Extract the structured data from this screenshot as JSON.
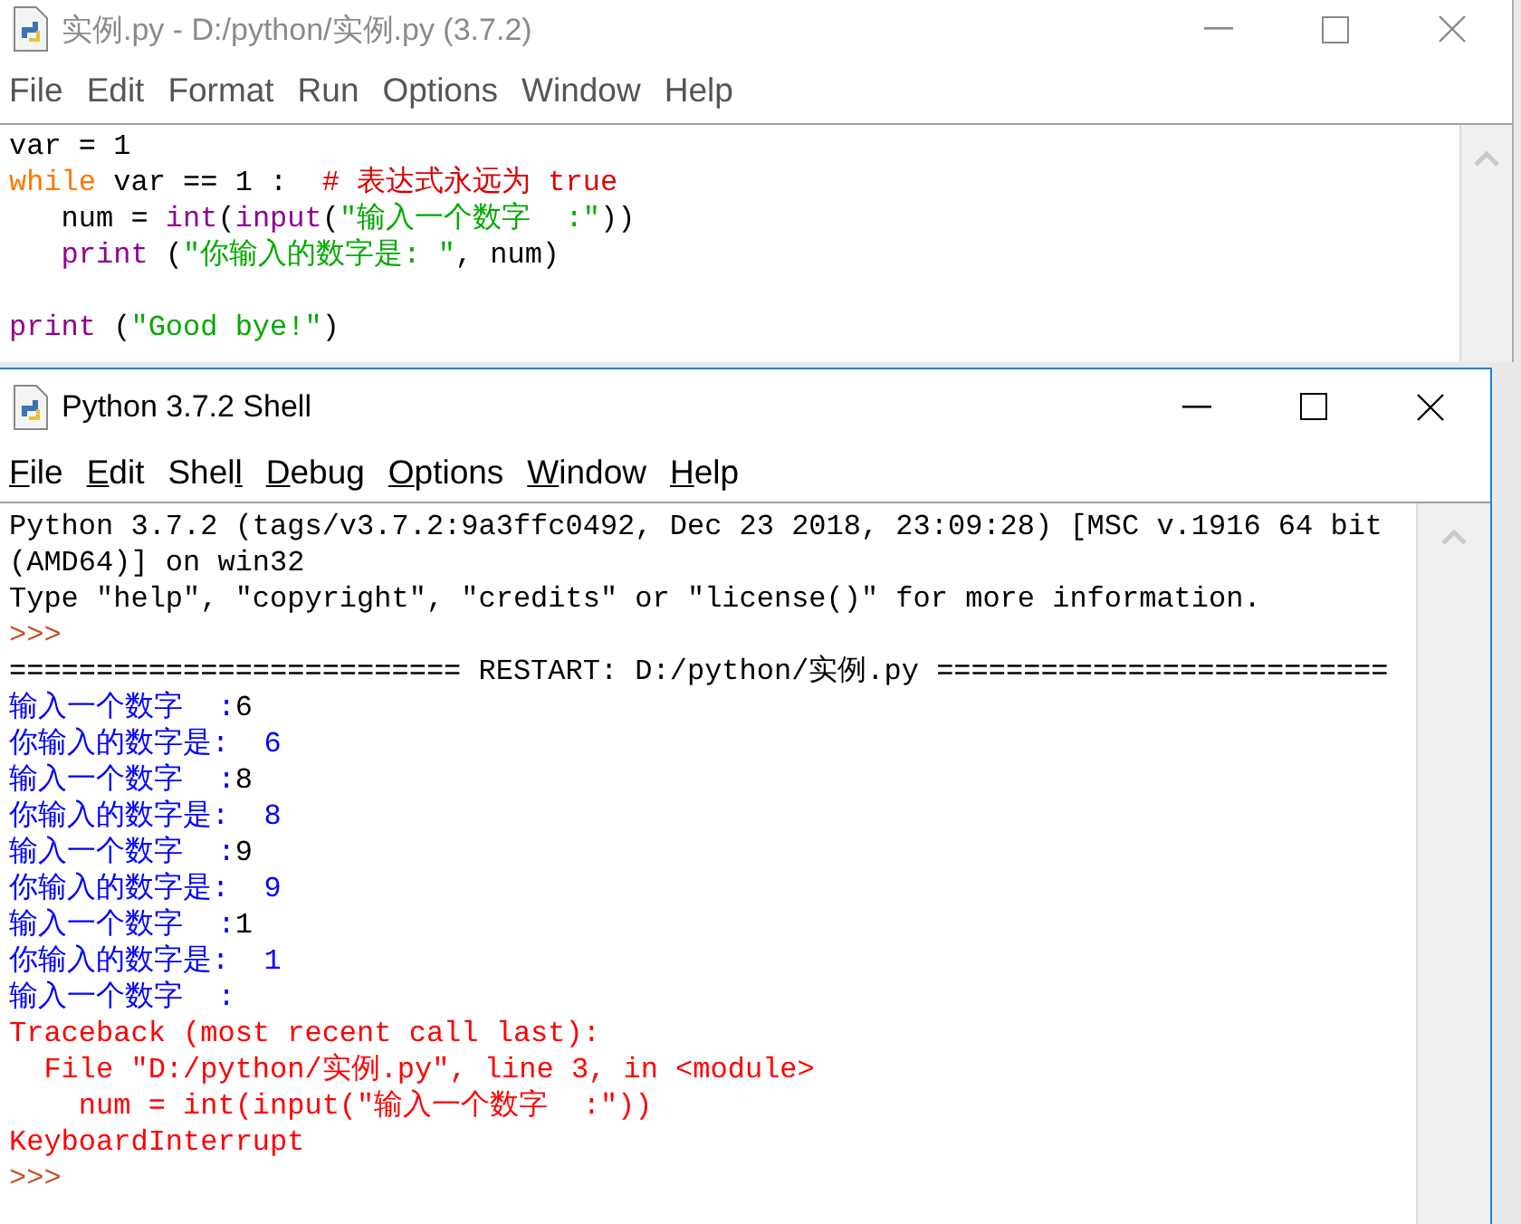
{
  "windows": [
    {
      "title": "实例.py - D:/python/实例.py (3.7.2)",
      "active": false,
      "kind": "editor",
      "menu": [
        {
          "after": "File"
        },
        {
          "after": "Edit"
        },
        {
          "after": "Format"
        },
        {
          "after": "Run"
        },
        {
          "after": "Options"
        },
        {
          "after": "Window"
        },
        {
          "after": "Help"
        }
      ],
      "lines": [
        {
          "kind": "code",
          "segments": [
            {
              "text": "var = 1",
              "kind": "default"
            }
          ]
        },
        {
          "kind": "code",
          "segments": [
            {
              "text": "while",
              "kind": "keyword"
            },
            {
              "text": " var == 1 :  ",
              "kind": "default"
            },
            {
              "text": "# 表达式永远为 true",
              "kind": "comment"
            }
          ]
        },
        {
          "kind": "code",
          "segments": [
            {
              "text": "   num = ",
              "kind": "default"
            },
            {
              "text": "int",
              "kind": "builtin"
            },
            {
              "text": "(",
              "kind": "default"
            },
            {
              "text": "input",
              "kind": "builtin"
            },
            {
              "text": "(",
              "kind": "default"
            },
            {
              "text": "\"输入一个数字  :\"",
              "kind": "string"
            },
            {
              "text": "))",
              "kind": "default"
            }
          ]
        },
        {
          "kind": "code",
          "segments": [
            {
              "text": "   print",
              "kind": "builtin"
            },
            {
              "text": " (",
              "kind": "default"
            },
            {
              "text": "\"你输入的数字是: \"",
              "kind": "string"
            },
            {
              "text": ", num)",
              "kind": "default"
            }
          ]
        },
        {
          "kind": "blank"
        },
        {
          "kind": "code",
          "segments": [
            {
              "text": "print",
              "kind": "builtin"
            },
            {
              "text": " (",
              "kind": "default"
            },
            {
              "text": "\"Good bye!\"",
              "kind": "string"
            },
            {
              "text": ")",
              "kind": "default"
            }
          ]
        }
      ]
    },
    {
      "title": "Python 3.7.2 Shell",
      "active": true,
      "kind": "shell",
      "menu": [
        {
          "key": "F",
          "after": "ile"
        },
        {
          "key": "E",
          "after": "dit"
        },
        {
          "before": "Shel",
          "key": "l"
        },
        {
          "key": "D",
          "after": "ebug"
        },
        {
          "key": "O",
          "after": "ptions"
        },
        {
          "key": "W",
          "after": "indow"
        },
        {
          "key": "H",
          "after": "elp"
        }
      ],
      "lines": [
        {
          "kind": "code",
          "segments": [
            {
              "text": "Python 3.7.2 (tags/v3.7.2:9a3ffc0492, Dec 23 2018, 23:09:28) [MSC v.1916 64 bit",
              "kind": "default"
            }
          ]
        },
        {
          "kind": "code",
          "segments": [
            {
              "text": "(AMD64)] on win32",
              "kind": "default"
            }
          ]
        },
        {
          "kind": "code",
          "segments": [
            {
              "text": "Type \"help\", \"copyright\", \"credits\" or \"license()\" for more information.",
              "kind": "default"
            }
          ]
        },
        {
          "kind": "code",
          "segments": [
            {
              "text": ">>>",
              "kind": "prompt"
            }
          ]
        },
        {
          "kind": "code",
          "segments": [
            {
              "text": "========================== RESTART: D:/python/实例.py ==========================",
              "kind": "default"
            }
          ]
        },
        {
          "kind": "code",
          "segments": [
            {
              "text": "输入一个数字  :",
              "kind": "stdout"
            },
            {
              "text": "6",
              "kind": "stdin"
            }
          ]
        },
        {
          "kind": "code",
          "segments": [
            {
              "text": "你输入的数字是:  6",
              "kind": "stdout"
            }
          ]
        },
        {
          "kind": "code",
          "segments": [
            {
              "text": "输入一个数字  :",
              "kind": "stdout"
            },
            {
              "text": "8",
              "kind": "stdin"
            }
          ]
        },
        {
          "kind": "code",
          "segments": [
            {
              "text": "你输入的数字是:  8",
              "kind": "stdout"
            }
          ]
        },
        {
          "kind": "code",
          "segments": [
            {
              "text": "输入一个数字  :",
              "kind": "stdout"
            },
            {
              "text": "9",
              "kind": "stdin"
            }
          ]
        },
        {
          "kind": "code",
          "segments": [
            {
              "text": "你输入的数字是:  9",
              "kind": "stdout"
            }
          ]
        },
        {
          "kind": "code",
          "segments": [
            {
              "text": "输入一个数字  :",
              "kind": "stdout"
            },
            {
              "text": "1",
              "kind": "stdin"
            }
          ]
        },
        {
          "kind": "code",
          "segments": [
            {
              "text": "你输入的数字是:  1",
              "kind": "stdout"
            }
          ]
        },
        {
          "kind": "code",
          "segments": [
            {
              "text": "输入一个数字  :",
              "kind": "stdout"
            }
          ]
        },
        {
          "kind": "code",
          "segments": [
            {
              "text": "Traceback (most recent call last):",
              "kind": "stderr"
            }
          ]
        },
        {
          "kind": "code",
          "segments": [
            {
              "text": "  File \"D:/python/实例.py\", line 3, in <module>",
              "kind": "stderr"
            }
          ]
        },
        {
          "kind": "code",
          "segments": [
            {
              "text": "    num = int(input(\"输入一个数字  :\"))",
              "kind": "stderr"
            }
          ]
        },
        {
          "kind": "code",
          "segments": [
            {
              "text": "KeyboardInterrupt",
              "kind": "stderr"
            }
          ]
        },
        {
          "kind": "code",
          "segments": [
            {
              "text": ">>>",
              "kind": "prompt"
            }
          ]
        }
      ]
    }
  ]
}
